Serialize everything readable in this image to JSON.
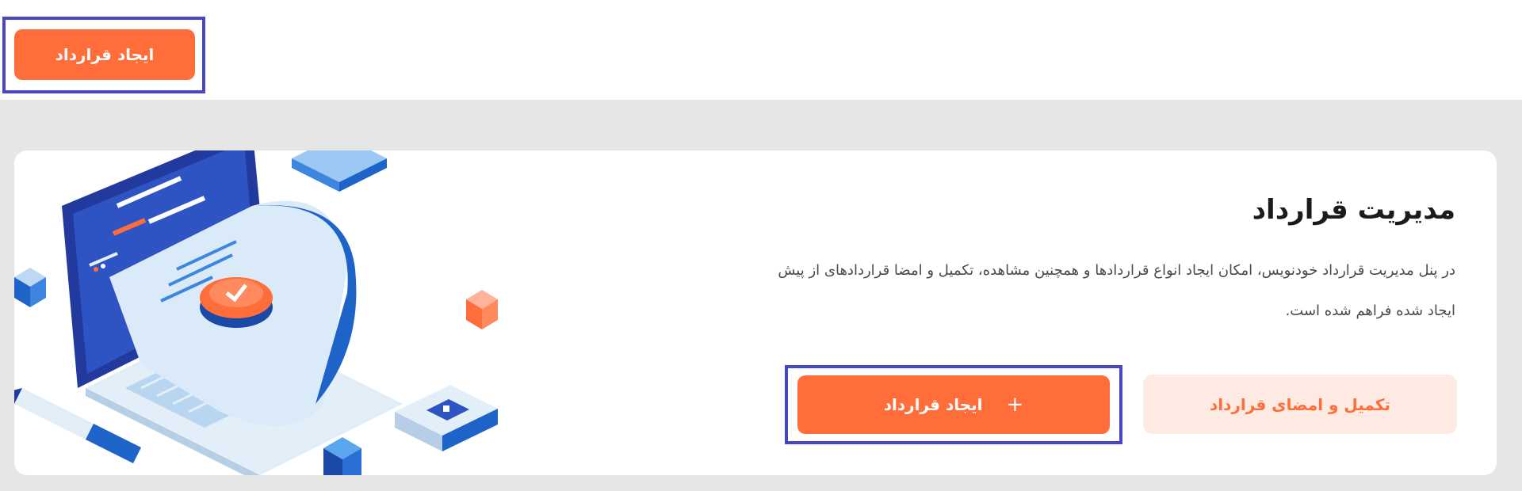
{
  "top": {
    "create_button_label": "ایجاد قرارداد"
  },
  "card": {
    "title": "مدیریت قرارداد",
    "description": "در پنل مدیریت قرارداد خودنویس، امکان ایجاد انواع قراردادها و همچنین مشاهده، تکمیل و امضا قراردادهای از پیش ایجاد شده فراهم شده است.",
    "create_button": {
      "label": "ایجاد قرارداد",
      "icon_name": "plus-icon",
      "icon_glyph": "+"
    },
    "complete_button_label": "تکمیل و امضای قرارداد"
  },
  "colors": {
    "accent": "#ff6d3b",
    "accent_soft": "#fdebe3",
    "highlight_frame": "#4747c2",
    "page_bg": "#e6e6e6",
    "illustration_blue": "#1e63c8",
    "illustration_dark_blue": "#223a9e"
  }
}
